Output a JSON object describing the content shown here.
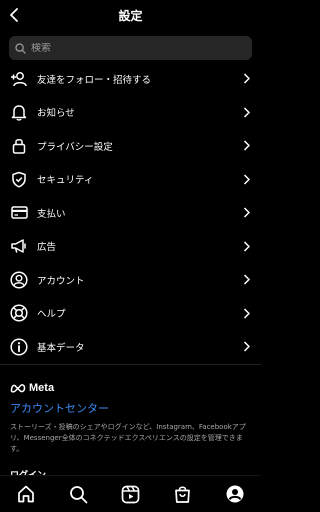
{
  "header": {
    "title": "設定"
  },
  "search": {
    "placeholder": "検索"
  },
  "menu": {
    "items": [
      {
        "label": "友達をフォロー・招待する",
        "icon": "add-person-icon"
      },
      {
        "label": "お知らせ",
        "icon": "bell-icon"
      },
      {
        "label": "プライバシー設定",
        "icon": "lock-icon"
      },
      {
        "label": "セキュリティ",
        "icon": "shield-icon"
      },
      {
        "label": "支払い",
        "icon": "card-icon"
      },
      {
        "label": "広告",
        "icon": "megaphone-icon"
      },
      {
        "label": "アカウント",
        "icon": "account-icon"
      },
      {
        "label": "ヘルプ",
        "icon": "lifebuoy-icon"
      },
      {
        "label": "基本データ",
        "icon": "info-icon"
      }
    ]
  },
  "meta": {
    "brand": "Meta",
    "accounts_center": "アカウントセンター",
    "description": "ストーリーズ・投稿のシェアやログインなど、Instagram、Facebookアプリ、Messenger全体のコネクテッドエクスペリエンスの設定を管理できます。",
    "next_section_partial": "ログイン"
  },
  "tabbar": {
    "tabs": [
      "home-icon",
      "search-icon",
      "reels-icon",
      "shop-icon",
      "profile-icon"
    ]
  }
}
